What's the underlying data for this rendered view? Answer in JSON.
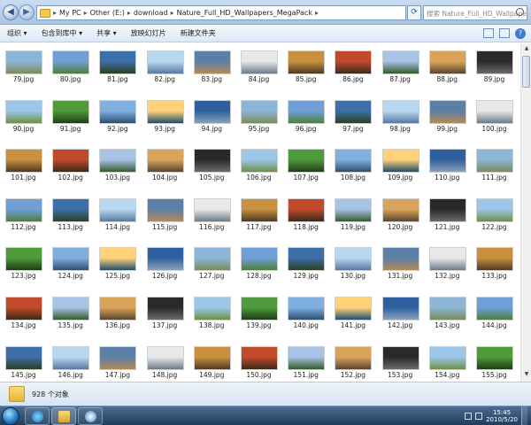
{
  "window": {
    "breadcrumbs": [
      "My PC",
      "Other (E:)",
      "download",
      "Nature_Full_HD_Wallpapers_MegaPack"
    ],
    "search_placeholder": "搜索 Nature_Full_HD_Wallpapers_..."
  },
  "toolbar": {
    "organize": "组织 ▾",
    "include": "包含到库中 ▾",
    "share": "共享 ▾",
    "slideshow": "放映幻灯片",
    "new_folder": "新建文件夹"
  },
  "files": {
    "start_number": 79,
    "end_number": 155,
    "extension": ".jpg",
    "columns": 11
  },
  "status": {
    "item_count": "928 个对象"
  },
  "taskbar": {
    "time": "15:45",
    "date": "2010/5/20"
  },
  "colors": {
    "accent": "#3d7bd0",
    "taskbar": "#213b5b"
  }
}
